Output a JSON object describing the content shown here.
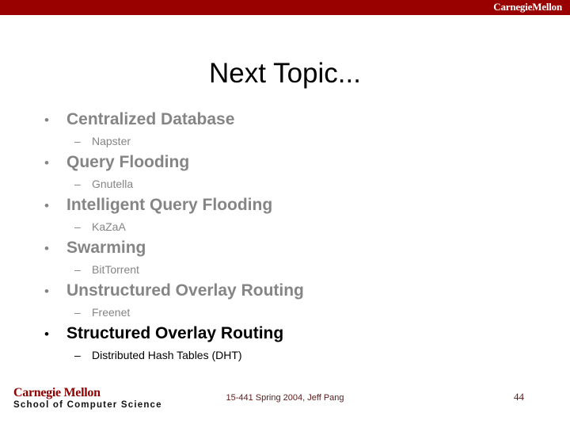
{
  "colors": {
    "header_bar": "#990000",
    "dim_text": "#858585",
    "active_text": "#000000",
    "footer_red": "#8c0000",
    "footer_maroon": "#5c1a1a"
  },
  "header": {
    "logo": "CarnegieMellon"
  },
  "title": "Next Topic...",
  "topics": [
    {
      "bullet_mark": "•",
      "label": "Centralized Database",
      "sub_mark": "–",
      "sub_label": "Napster",
      "state": "dim"
    },
    {
      "bullet_mark": "•",
      "label": "Query Flooding",
      "sub_mark": "–",
      "sub_label": "Gnutella",
      "state": "dim"
    },
    {
      "bullet_mark": "•",
      "label": "Intelligent Query Flooding",
      "sub_mark": "–",
      "sub_label": "KaZaA",
      "state": "dim"
    },
    {
      "bullet_mark": "•",
      "label": "Swarming",
      "sub_mark": "–",
      "sub_label": "BitTorrent",
      "state": "dim"
    },
    {
      "bullet_mark": "•",
      "label": "Unstructured Overlay Routing",
      "sub_mark": "–",
      "sub_label": "Freenet",
      "state": "dim"
    },
    {
      "bullet_mark": "•",
      "label": "Structured Overlay Routing",
      "sub_mark": "–",
      "sub_label": "Distributed Hash Tables (DHT)",
      "state": "active"
    }
  ],
  "footer": {
    "logo_top": "Carnegie Mellon",
    "logo_bottom": "School of Computer Science",
    "center": "15-441 Spring 2004, Jeff Pang",
    "page_number": "44"
  }
}
